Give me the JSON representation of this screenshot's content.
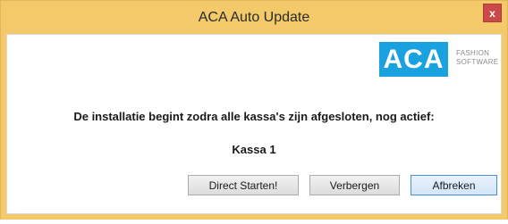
{
  "window": {
    "title": "ACA Auto Update",
    "close_label": "x"
  },
  "logo": {
    "text": "ACA",
    "sub_line1": "FASHION",
    "sub_line2": "SOFTWARE",
    "brand_color": "#1aa1df"
  },
  "message": {
    "text": "De installatie begint zodra alle kassa's zijn afgesloten, nog actief:",
    "active_item": "Kassa 1"
  },
  "buttons": {
    "start": "Direct Starten!",
    "hide": "Verbergen",
    "cancel": "Afbreken"
  },
  "colors": {
    "titlebar": "#f3c96a",
    "close": "#c94a49"
  }
}
